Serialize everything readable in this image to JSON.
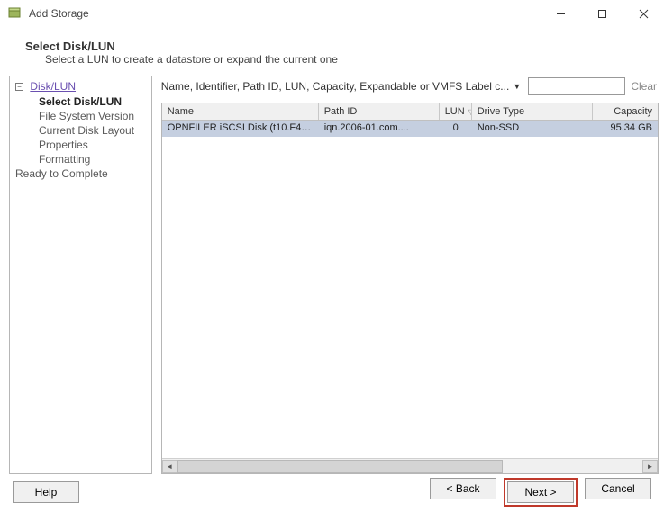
{
  "window": {
    "title": "Add Storage"
  },
  "wizard": {
    "heading": "Select Disk/LUN",
    "subheading": "Select a LUN to create a datastore or expand the current one"
  },
  "nav": {
    "root_label": "Disk/LUN",
    "items": [
      {
        "label": "Select Disk/LUN",
        "bold": true
      },
      {
        "label": "File System Version",
        "bold": false
      },
      {
        "label": "Current Disk Layout",
        "bold": false
      },
      {
        "label": "Properties",
        "bold": false
      },
      {
        "label": "Formatting",
        "bold": false
      }
    ],
    "last_label": "Ready to Complete"
  },
  "filter": {
    "label": "Name, Identifier, Path ID, LUN, Capacity, Expandable or VMFS Label c...",
    "search_value": "",
    "clear_label": "Clear"
  },
  "table": {
    "columns": {
      "name": "Name",
      "path": "Path ID",
      "lun": "LUN",
      "drive": "Drive Type",
      "capacity": "Capacity"
    },
    "rows": [
      {
        "name": "OPNFILER iSCSI Disk (t10.F405E464...",
        "path": "iqn.2006-01.com....",
        "lun": "0",
        "drive": "Non-SSD",
        "capacity": "95.34 GB",
        "selected": true
      }
    ]
  },
  "footer": {
    "help": "Help",
    "back": "< Back",
    "next": "Next >",
    "cancel": "Cancel"
  }
}
